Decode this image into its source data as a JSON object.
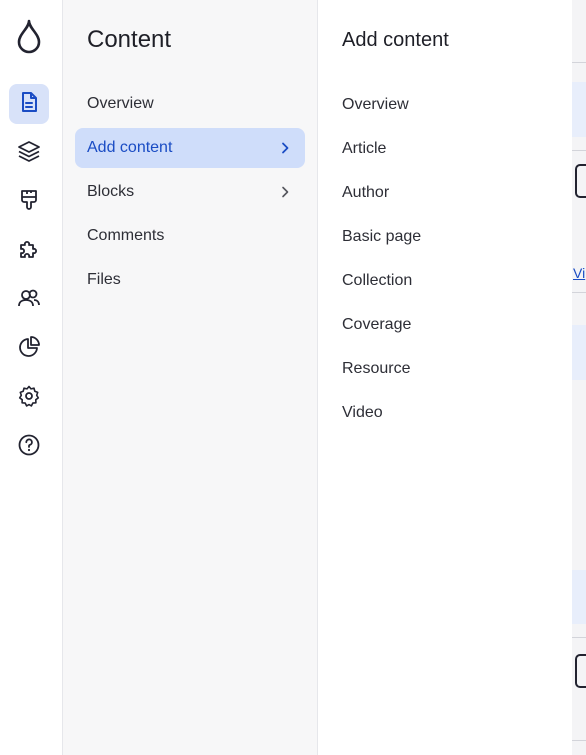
{
  "rail": {
    "items": [
      {
        "name": "content",
        "icon": "document-icon",
        "active": true
      },
      {
        "name": "structure",
        "icon": "layers-icon",
        "active": false
      },
      {
        "name": "appearance",
        "icon": "brush-icon",
        "active": false
      },
      {
        "name": "extend",
        "icon": "puzzle-icon",
        "active": false
      },
      {
        "name": "people",
        "icon": "users-icon",
        "active": false
      },
      {
        "name": "reports",
        "icon": "pie-chart-icon",
        "active": false
      },
      {
        "name": "configuration",
        "icon": "gear-icon",
        "active": false
      },
      {
        "name": "help",
        "icon": "help-icon",
        "active": false
      }
    ],
    "active_color": "#d8e2f9"
  },
  "content_menu": {
    "title": "Content",
    "items": [
      {
        "label": "Overview"
      },
      {
        "label": "Add content",
        "active": true
      },
      {
        "label": "Blocks"
      },
      {
        "label": "Comments"
      },
      {
        "label": "Files"
      }
    ]
  },
  "add_menu": {
    "title": "Add content",
    "items": [
      {
        "label": "Overview"
      },
      {
        "label": "Article"
      },
      {
        "label": "Author"
      },
      {
        "label": "Basic page"
      },
      {
        "label": "Collection"
      },
      {
        "label": "Coverage"
      },
      {
        "label": "Resource"
      },
      {
        "label": "Video"
      }
    ]
  },
  "background_page": {
    "link_text": "Vi"
  },
  "colors": {
    "accent": "#1a4cc4",
    "active_bg": "#cfddfa"
  }
}
